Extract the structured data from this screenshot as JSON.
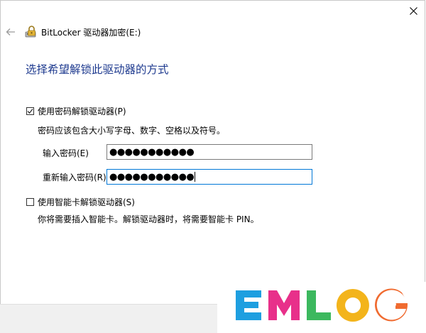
{
  "window": {
    "title": "BitLocker 驱动器加密(E:)",
    "close_glyph": "✕",
    "back_glyph": "←"
  },
  "page": {
    "heading": "选择希望解锁此驱动器的方式"
  },
  "password_option": {
    "checked": true,
    "label": "使用密码解锁驱动器(P)",
    "hint": "密码应该包含大小写字母、数字、空格以及符号。",
    "enter_label": "输入密码(E)",
    "enter_value": "●●●●●●●●●●●",
    "reenter_label": "重新输入密码(R)",
    "reenter_value": "●●●●●●●●●●●"
  },
  "smartcard_option": {
    "checked": false,
    "label": "使用智能卡解锁驱动器(S)",
    "hint": "你将需要插入智能卡。解锁驱动器时，将需要智能卡 PIN。"
  },
  "watermark": {
    "text": "EMLOG",
    "colors": [
      "#1e9fe0",
      "#e8308a",
      "#3cb85e",
      "#f3b41b",
      "#f06b30"
    ]
  },
  "colors": {
    "heading": "#1e3a8f",
    "focus_border": "#0078d7",
    "footer": "#f0f0f0"
  }
}
